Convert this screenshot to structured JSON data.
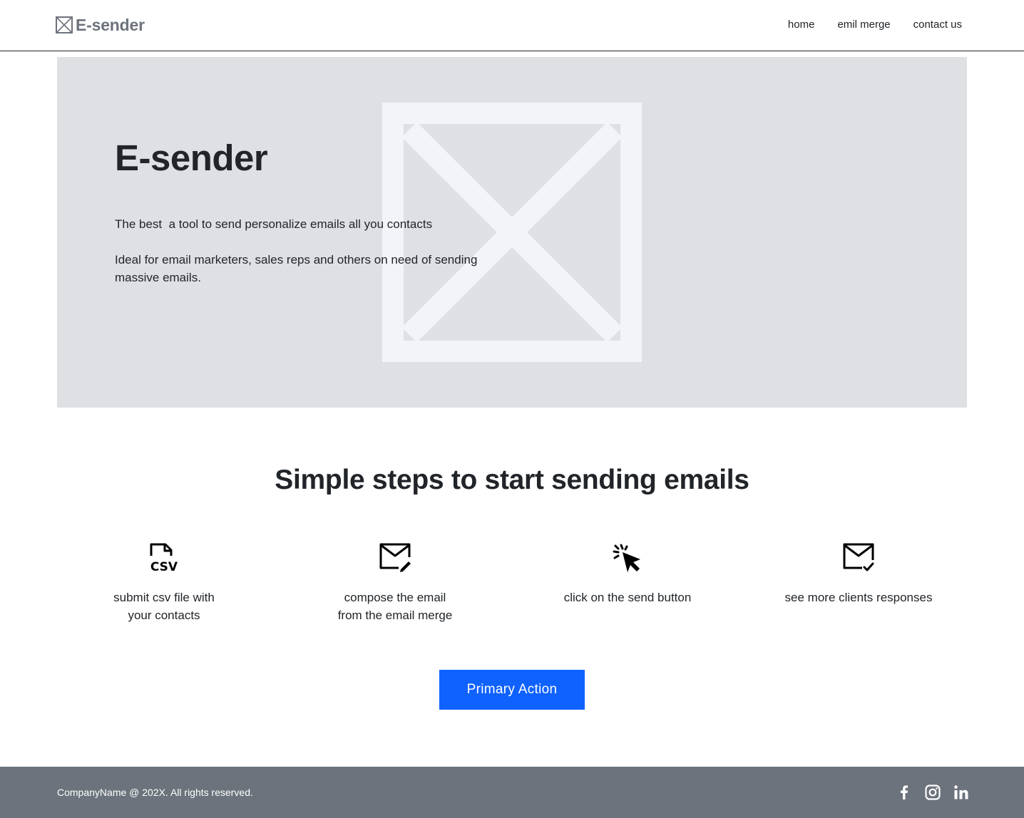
{
  "header": {
    "brand": "E-sender",
    "nav": [
      {
        "label": "home"
      },
      {
        "label": "emil merge"
      },
      {
        "label": "contact us"
      }
    ]
  },
  "hero": {
    "title": "E-sender",
    "line1": "The best  a tool to send personalize emails all you contacts",
    "line2": "Ideal for email marketers, sales reps and others on need of sending massive emails.",
    "image_icon": "image-placeholder-icon"
  },
  "steps": {
    "title": "Simple steps to start sending emails",
    "items": [
      {
        "icon": "csv-file-icon",
        "text": "submit csv file with\nyour contacts"
      },
      {
        "icon": "mail-edit-icon",
        "text": "compose the email\nfrom the email merge"
      },
      {
        "icon": "cursor-click-icon",
        "text": "click on the send button"
      },
      {
        "icon": "mail-check-icon",
        "text": "see more clients responses"
      }
    ]
  },
  "cta": {
    "label": "Primary Action"
  },
  "footer": {
    "copyright": "CompanyName @ 202X. All rights reserved.",
    "social": [
      "facebook-icon",
      "instagram-icon",
      "linkedin-icon"
    ]
  },
  "colors": {
    "primary": "#0f62fe",
    "hero_bg": "#dee0e4",
    "placeholder": "#f2f4f8",
    "footer_bg": "#6c737c",
    "text": "#212529",
    "brand": "#6c737c"
  }
}
